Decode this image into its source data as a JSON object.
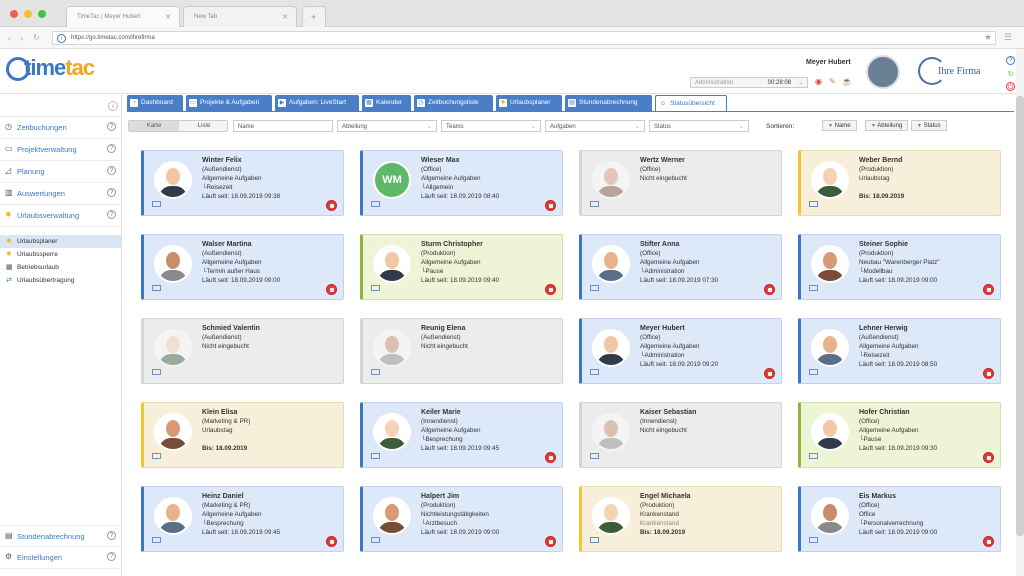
{
  "browser": {
    "tabs": [
      "TimeTac | Meyer Hubert",
      "New Tab"
    ],
    "new_tab_symbol": "+",
    "url": "https://go.timetac.com/ihrefirma"
  },
  "header": {
    "logo_text_a": "time",
    "logo_text_b": "tac",
    "user_name": "Meyer Hubert",
    "mode_label": "Administration",
    "timer": "00:28:08",
    "company_logo_text": "Ihre Firma"
  },
  "sidebar": {
    "collapse_symbol": "‹",
    "items_top": [
      {
        "label": "Zeitbuchungen",
        "icon": "clock-icon"
      },
      {
        "label": "Projektverwaltung",
        "icon": "folder-icon"
      },
      {
        "label": "Planung",
        "icon": "chart-icon"
      },
      {
        "label": "Auswertungen",
        "icon": "bar-chart-icon"
      },
      {
        "label": "Urlaubsverwaltung",
        "icon": "sun-icon"
      }
    ],
    "sub_items": [
      "Urlaubsplaner",
      "Urlaubssperre",
      "Betriebsurlaub",
      "Urlaubsübertragung"
    ],
    "items_bottom": [
      {
        "label": "Stundenabrechnung",
        "icon": "calculator-icon"
      },
      {
        "label": "Einstellungen",
        "icon": "gear-icon"
      }
    ],
    "help": "?"
  },
  "tabs": [
    "Dashboard",
    "Projekte & Aufgaben",
    "Aufgaben: LiveStart",
    "Kalender",
    "Zeitbuchungsliste",
    "Urlaubsplaner",
    "Stundenabrechnung",
    "Statusübersicht"
  ],
  "filters": {
    "view_card": "Karte",
    "view_list": "Liste",
    "name": "Name",
    "department": "Abteilung",
    "teams": "Teams",
    "tasks": "Aufgaben",
    "status": "Status",
    "sort_label": "Sortieren:",
    "sort_name": "Name",
    "sort_department": "Abteilung",
    "sort_status": "Status"
  },
  "cards": [
    {
      "name": "Winter Felix",
      "dept": "(Außendienst)",
      "l1": "Allgemeine Aufgaben",
      "l2": "└Reisezeit",
      "l3": "Läuft seit: 18.09.2019 09:38",
      "color": "blue",
      "stop": true
    },
    {
      "name": "Wieser Max",
      "dept": "(Office)",
      "l1": "Allgemeine Aufgaben",
      "l2": "└Allgemein",
      "l3": "Läuft seit: 18.09.2019 08:40",
      "color": "blue",
      "stop": true,
      "initials": "WM"
    },
    {
      "name": "Wertz Werner",
      "dept": "(Office)",
      "l1": "Nicht eingebucht",
      "l2": "",
      "l3": "",
      "color": "grey",
      "stop": false,
      "faded": true
    },
    {
      "name": "Weber Bernd",
      "dept": "(Produktion)",
      "l1": "Urlaubstag",
      "l2": "",
      "l3": "Bis: 18.09.2019",
      "color": "yellow",
      "stop": false,
      "bold_l3": true
    },
    {
      "name": "Walser Martina",
      "dept": "(Außendienst)",
      "l1": "Allgemeine Aufgaben",
      "l2": "└Termin außer Haus",
      "l3": "Läuft seit: 18.09.2019 09:00",
      "color": "blue",
      "stop": true
    },
    {
      "name": "Sturm Christopher",
      "dept": "(Produktion)",
      "l1": "Allgemeine Aufgaben",
      "l2": "└Pause",
      "l3": "Läuft seit: 18.09.2019 09:40",
      "color": "green",
      "stop": true
    },
    {
      "name": "Stifter Anna",
      "dept": "(Office)",
      "l1": "Allgemeine Aufgaben",
      "l2": "└Administration",
      "l3": "Läuft seit: 18.09.2019 07:30",
      "color": "blue",
      "stop": true
    },
    {
      "name": "Steiner Sophie",
      "dept": "(Produktion)",
      "l1": "Neubau \"Warenberger Platz\"",
      "l2": "└Modellbau",
      "l3": "Läuft seit: 18.09.2019 09:00",
      "color": "blue",
      "stop": true
    },
    {
      "name": "Schmied Valentin",
      "dept": "(Außendienst)",
      "l1": "Nicht eingebucht",
      "l2": "",
      "l3": "",
      "color": "grey",
      "stop": false,
      "faded": true
    },
    {
      "name": "Reunig Elena",
      "dept": "(Außendienst)",
      "l1": "Nicht eingebucht",
      "l2": "",
      "l3": "",
      "color": "grey",
      "stop": false,
      "faded": true
    },
    {
      "name": "Meyer Hubert",
      "dept": "(Office)",
      "l1": "Allgemeine Aufgaben",
      "l2": "└Administration",
      "l3": "Läuft seit: 18.09.2019 09:20",
      "color": "blue",
      "stop": true
    },
    {
      "name": "Lehner Herwig",
      "dept": "(Außendienst)",
      "l1": "Allgemeine Aufgaben",
      "l2": "└Reisezeit",
      "l3": "Läuft seit: 18.09.2019 08:50",
      "color": "blue",
      "stop": true
    },
    {
      "name": "Klein Elisa",
      "dept": "(Marketing & PR)",
      "l1": "Urlaubstag",
      "l2": "",
      "l3": "Bis: 18.09.2019",
      "color": "yellow",
      "stop": false,
      "bold_l3": true
    },
    {
      "name": "Keiler Marie",
      "dept": "(Innendienst)",
      "l1": "Allgemeine Aufgaben",
      "l2": "└Besprechung",
      "l3": "Läuft seit: 18.09.2019 09:45",
      "color": "blue",
      "stop": true
    },
    {
      "name": "Kaiser Sebastian",
      "dept": "(Innendienst)",
      "l1": "Nicht eingebucht",
      "l2": "",
      "l3": "",
      "color": "grey",
      "stop": false,
      "faded": true
    },
    {
      "name": "Hofer Christian",
      "dept": "(Office)",
      "l1": "Allgemeine Aufgaben",
      "l2": "└Pause",
      "l3": "Läuft seit: 18.09.2019 09:30",
      "color": "green",
      "stop": true
    },
    {
      "name": "Heinz Daniel",
      "dept": "(Marketing & PR)",
      "l1": "Allgemeine Aufgaben",
      "l2": "└Besprechung",
      "l3": "Läuft seit: 18.09.2019 09:45",
      "color": "blue",
      "stop": true
    },
    {
      "name": "Halpert Jim",
      "dept": "(Produktion)",
      "l1": "Nichtleistungstätigkeiten",
      "l2": "└Arztbesuch",
      "l3": "Läuft seit: 18.09.2019 09:00",
      "color": "blue",
      "stop": true
    },
    {
      "name": "Engel Michaela",
      "dept": "(Produktion)",
      "l1": "Krankenstand",
      "l2": "Krankenstand",
      "l3": "Bis: 18.09.2019",
      "color": "yellow",
      "stop": false,
      "bold_l3": true
    },
    {
      "name": "Eis Markus",
      "dept": "(Office)",
      "l1": "Office",
      "l2": "└Personalverrechnung",
      "l3": "Läuft seit: 18.09.2019 09:00",
      "color": "blue",
      "stop": true
    }
  ]
}
